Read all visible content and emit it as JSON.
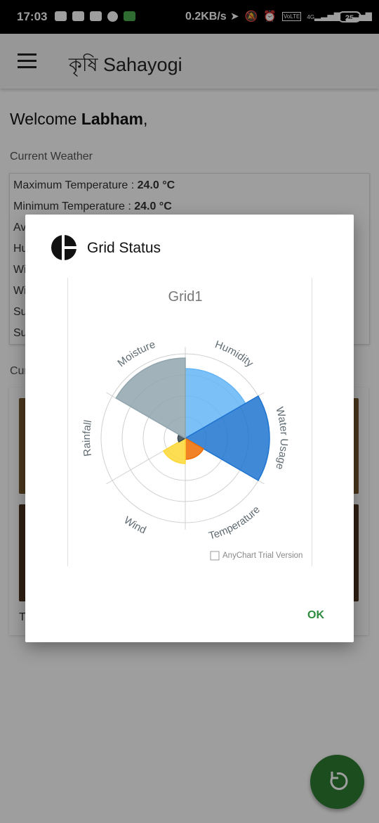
{
  "status_bar": {
    "time": "17:03",
    "net_speed": "0.2KB/s",
    "network_labels": [
      "4G",
      "VoLTE"
    ],
    "battery": "25"
  },
  "app_bar": {
    "title": "কৃষি Sahayogi"
  },
  "main": {
    "welcome_prefix": "Welcome ",
    "user_name": "Labham",
    "welcome_suffix": ",",
    "weather_section_label": "Current Weather",
    "weather_rows": [
      {
        "label": "Maximum Temperature : ",
        "value": "24.0 °C"
      },
      {
        "label": "Minimum Temperature : ",
        "value": "24.0 °C"
      },
      {
        "label": "Av",
        "value": ""
      },
      {
        "label": "Hu",
        "value": ""
      },
      {
        "label": "Wi",
        "value": ""
      },
      {
        "label": "Wi",
        "value": ""
      },
      {
        "label": "Su",
        "value": ""
      },
      {
        "label": "Su",
        "value": ""
      }
    ],
    "crop_section_label": "Cur",
    "crop_footer_text": "T"
  },
  "dialog": {
    "title": "Grid Status",
    "ok_label": "OK",
    "watermark": "AnyChart Trial Version"
  },
  "chart_data": {
    "type": "polar-area",
    "title": "Grid1",
    "categories": [
      "Humidity",
      "Water Usage",
      "Temperature",
      "Wind",
      "Rainfall",
      "Moisture"
    ],
    "values": [
      3.3,
      4.0,
      1.0,
      1.2,
      0.35,
      3.8
    ],
    "ymax": 4,
    "colors": [
      "#64b5f6",
      "#1e74d0",
      "#ef6c00",
      "#fdd835",
      "#37474f",
      "#90a4ae"
    ],
    "grid": true
  },
  "fab": {
    "icon": "refresh-icon"
  }
}
